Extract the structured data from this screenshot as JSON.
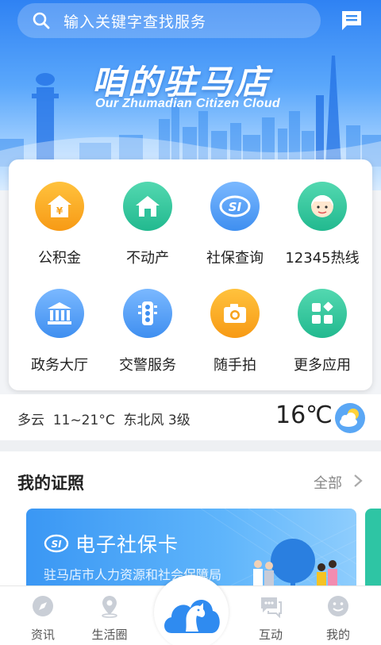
{
  "search": {
    "placeholder": "输入关键字查找服务"
  },
  "header": {
    "message_icon": "message-icon"
  },
  "brand": {
    "title": "咱的驻马店",
    "subtitle": "Our Zhumadian Citizen Cloud"
  },
  "services": [
    {
      "label": "公积金",
      "icon": "housing-fund-icon",
      "color": "#f7a21b"
    },
    {
      "label": "不动产",
      "icon": "real-estate-icon",
      "color": "#2ec29b"
    },
    {
      "label": "社保查询",
      "icon": "social-security-icon",
      "color": "#4a9ef5"
    },
    {
      "label": "12345热线",
      "icon": "hotline-icon",
      "color": "#2ec29b"
    },
    {
      "label": "政务大厅",
      "icon": "government-hall-icon",
      "color": "#4a9ef5"
    },
    {
      "label": "交警服务",
      "icon": "traffic-police-icon",
      "color": "#4a9ef5"
    },
    {
      "label": "随手拍",
      "icon": "camera-icon",
      "color": "#f7a21b"
    },
    {
      "label": "更多应用",
      "icon": "more-apps-icon",
      "color": "#2ec29b"
    }
  ],
  "weather": {
    "summary": "多云  11~21°C  东北风 3级",
    "temperature": "16℃",
    "icon": "cloudy-sun-icon"
  },
  "licenses": {
    "title": "我的证照",
    "all_label": "全部",
    "card": {
      "name": "电子社保卡",
      "org": "驻马店市人力资源和社会保障局"
    }
  },
  "tabbar": [
    {
      "label": "资讯",
      "icon": "compass-icon"
    },
    {
      "label": "生活圈",
      "icon": "location-pin-icon"
    },
    {
      "label": "",
      "icon": "horse-cloud-logo-icon"
    },
    {
      "label": "互动",
      "icon": "chat-bubbles-icon"
    },
    {
      "label": "我的",
      "icon": "smiley-face-icon"
    }
  ]
}
